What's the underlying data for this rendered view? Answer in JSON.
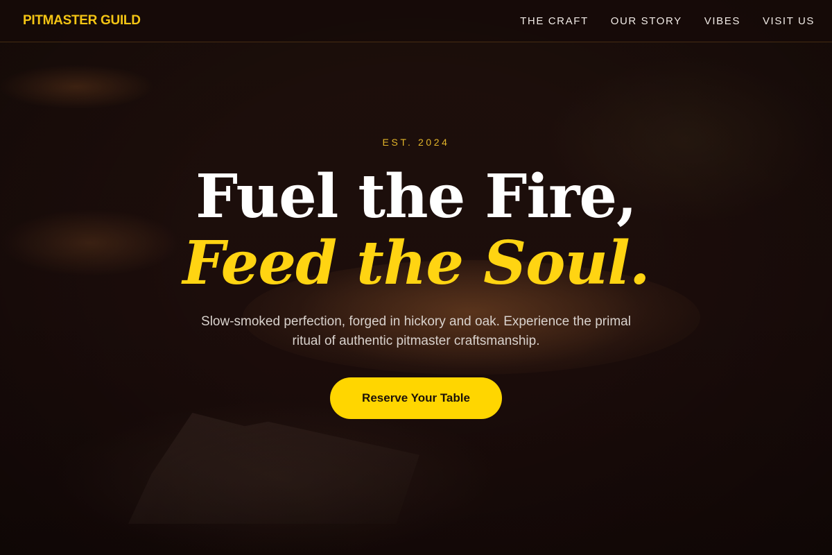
{
  "header": {
    "logo": "PITMASTER GUILD",
    "nav": [
      {
        "label": "THE CRAFT"
      },
      {
        "label": "OUR STORY"
      },
      {
        "label": "VIBES"
      },
      {
        "label": "VISIT US"
      }
    ]
  },
  "hero": {
    "eyebrow": "EST. 2024",
    "headline_line1": "Fuel the Fire,",
    "headline_line2": "Feed the Soul.",
    "subcopy": "Slow-smoked perfection, forged in hickory and oak. Experience the primal ritual of authentic pitmaster craftsmanship.",
    "cta_label": "Reserve Your Table"
  },
  "colors": {
    "accent": "#ffd600",
    "background": "#1a0c0a",
    "text": "#ffffff"
  }
}
